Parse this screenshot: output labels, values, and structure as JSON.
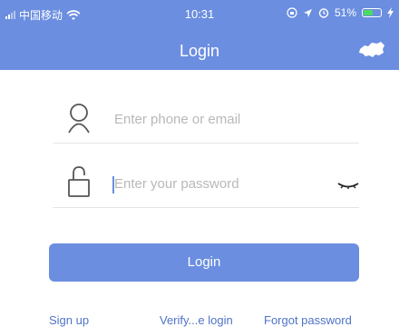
{
  "status_bar": {
    "carrier": "中国移动",
    "time": "10:31",
    "battery": "51%",
    "battery_level": 0.51
  },
  "nav": {
    "title": "Login",
    "right_icon": "map-icon"
  },
  "form": {
    "account_placeholder": "Enter phone or email",
    "password_placeholder": "Enter your password",
    "login_label": "Login"
  },
  "links": {
    "sign_up": "Sign up",
    "verify_login": "Verify...e login",
    "forgot_password": "Forgot password"
  },
  "colors": {
    "accent": "#6b8ee0",
    "link": "#4f73c8",
    "battery": "#4cd964"
  }
}
